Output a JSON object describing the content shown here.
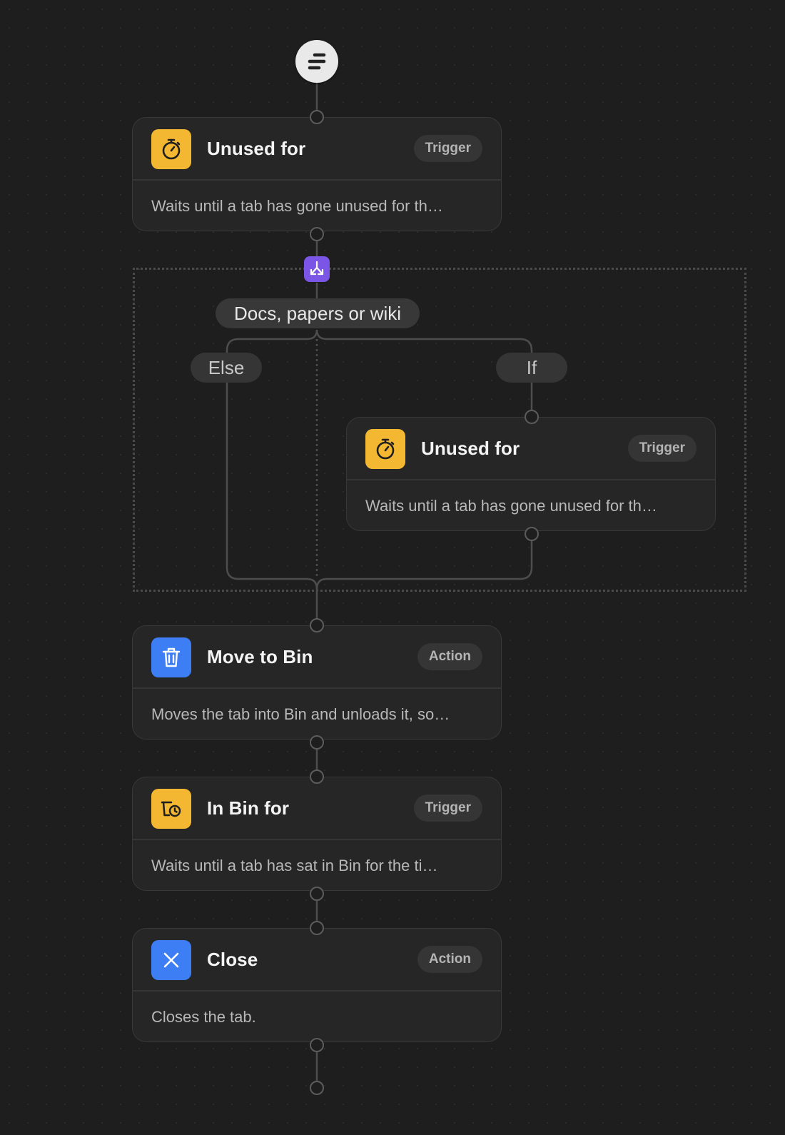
{
  "start": {
    "icon": "flow-start-icon"
  },
  "nodes": [
    {
      "title": "Unused for",
      "badge": "Trigger",
      "description": "Waits until a tab has gone unused for th…",
      "icon": "stopwatch-icon",
      "icon_color": "#f4b731"
    },
    {
      "title": "Unused for",
      "badge": "Trigger",
      "description": "Waits until a tab has gone unused for th…",
      "icon": "stopwatch-icon",
      "icon_color": "#f4b731"
    },
    {
      "title": "Move to Bin",
      "badge": "Action",
      "description": "Moves the tab into Bin and unloads it, so…",
      "icon": "trash-icon",
      "icon_color": "#3d7ef5"
    },
    {
      "title": "In Bin for",
      "badge": "Trigger",
      "description": "Waits until a tab has sat in Bin for the ti…",
      "icon": "bin-timer-icon",
      "icon_color": "#f4b731"
    },
    {
      "title": "Close",
      "badge": "Action",
      "description": "Closes the tab.",
      "icon": "close-x-icon",
      "icon_color": "#3d7ef5"
    }
  ],
  "condition": {
    "label": "Docs, papers or wiki",
    "icon": "split-arrows-icon",
    "icon_color": "#7b55e6",
    "else_label": "Else",
    "if_label": "If"
  }
}
